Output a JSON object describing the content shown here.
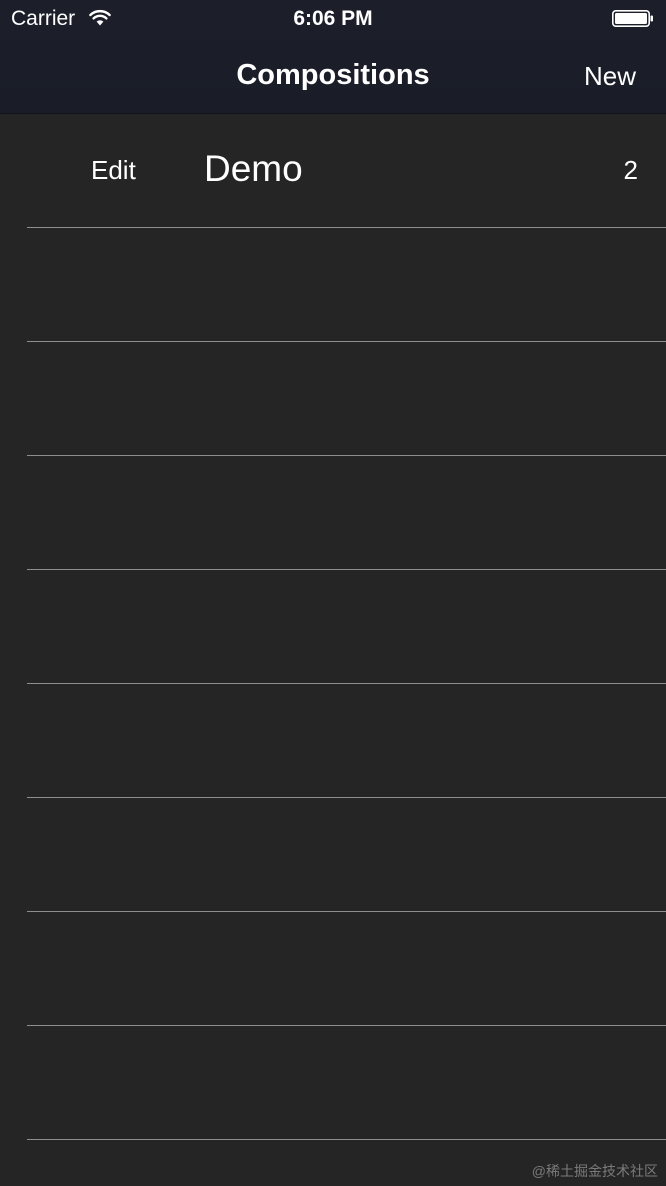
{
  "status_bar": {
    "carrier": "Carrier",
    "time": "6:06 PM",
    "wifi_icon": "wifi-icon",
    "battery_icon": "battery-icon"
  },
  "nav": {
    "title": "Compositions",
    "new_label": "New"
  },
  "compositions": {
    "rows": [
      {
        "edit_label": "Edit",
        "name": "Demo",
        "count": "2"
      },
      {
        "edit_label": "",
        "name": "",
        "count": ""
      },
      {
        "edit_label": "",
        "name": "",
        "count": ""
      },
      {
        "edit_label": "",
        "name": "",
        "count": ""
      },
      {
        "edit_label": "",
        "name": "",
        "count": ""
      },
      {
        "edit_label": "",
        "name": "",
        "count": ""
      },
      {
        "edit_label": "",
        "name": "",
        "count": ""
      },
      {
        "edit_label": "",
        "name": "",
        "count": ""
      },
      {
        "edit_label": "",
        "name": "",
        "count": ""
      }
    ]
  },
  "watermark": "@稀土掘金技术社区",
  "colors": {
    "background": "#252525",
    "nav_background": "#1c1f2a",
    "separator": "#8e8e8e",
    "text": "#ffffff"
  }
}
